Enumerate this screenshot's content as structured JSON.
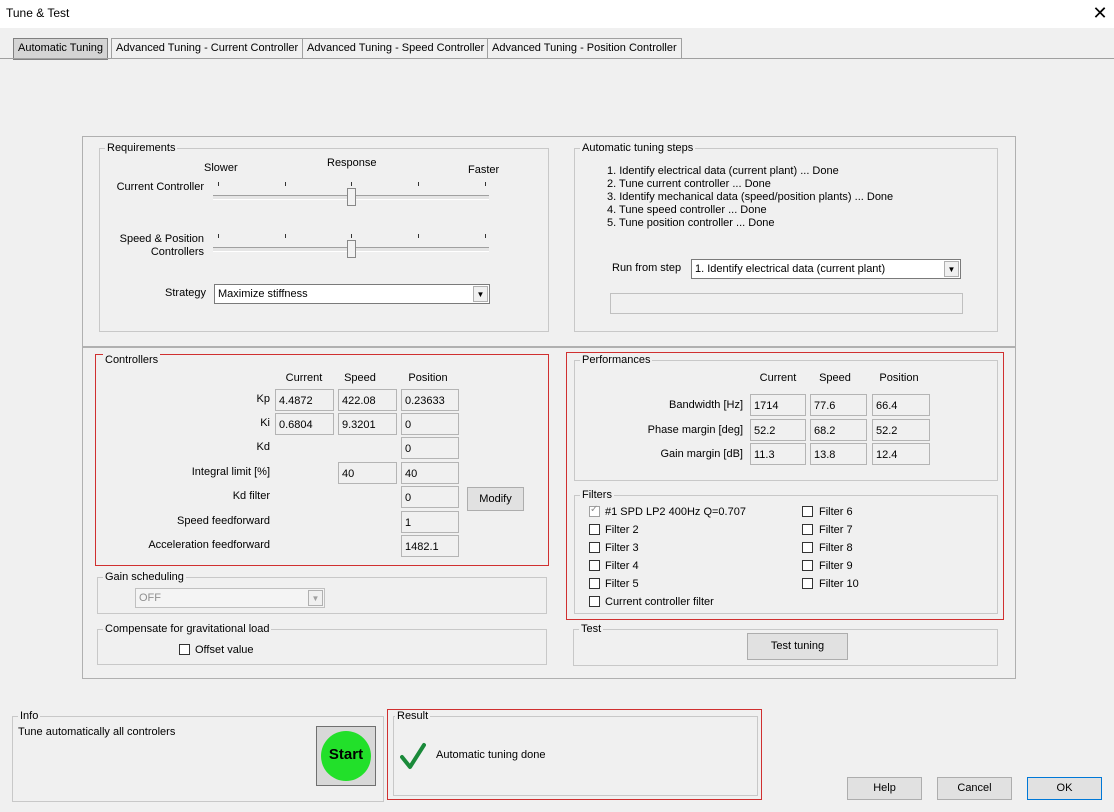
{
  "window": {
    "title": "Tune & Test"
  },
  "tabs": [
    "Automatic Tuning",
    "Advanced Tuning - Current Controller",
    "Advanced Tuning - Speed Controller",
    "Advanced Tuning - Position Controller"
  ],
  "requirements": {
    "label": "Requirements",
    "response": "Response",
    "slower": "Slower",
    "faster": "Faster",
    "current_controller": "Current Controller",
    "speed_position": "Speed & Position Controllers",
    "current_slider_position": 0.5,
    "speed_slider_position": 0.5,
    "strategy_label": "Strategy",
    "strategy_value": "Maximize stiffness"
  },
  "tuning_steps": {
    "label": "Automatic tuning steps",
    "steps": [
      "1. Identify electrical data (current plant) ... Done",
      "2. Tune current controller ... Done",
      "3. Identify mechanical data (speed/position plants) ... Done",
      "4. Tune speed controller ... Done",
      "5. Tune position controller ... Done"
    ],
    "run_from_label": "Run from step",
    "run_from_value": "1. Identify electrical data (current plant)"
  },
  "controllers": {
    "label": "Controllers",
    "headers": [
      "Current",
      "Speed",
      "Position"
    ],
    "kp_label": "Kp",
    "kp": [
      "4.4872",
      "422.08",
      "0.23633"
    ],
    "ki_label": "Ki",
    "ki": [
      "0.6804",
      "9.3201",
      "0"
    ],
    "kd_label": "Kd",
    "kd": "0",
    "integral_label": "Integral limit [%]",
    "integral": [
      "40",
      "40"
    ],
    "kdfilter_label": "Kd filter",
    "kdfilter": "0",
    "speedff_label": "Speed feedforward",
    "speedff": "1",
    "accelff_label": "Acceleration feedforward",
    "accelff": "1482.1",
    "modify": "Modify"
  },
  "gain_scheduling": {
    "label": "Gain scheduling",
    "value": "OFF"
  },
  "gravity": {
    "label": "Compensate for gravitational load",
    "offset": "Offset value"
  },
  "performances": {
    "label": "Performances",
    "headers": [
      "Current",
      "Speed",
      "Position"
    ],
    "bandwidth_label": "Bandwidth [Hz]",
    "bandwidth": [
      "1714",
      "77.6",
      "66.4"
    ],
    "phase_label": "Phase margin [deg]",
    "phase": [
      "52.2",
      "68.2",
      "52.2"
    ],
    "gain_label": "Gain margin [dB]",
    "gain": [
      "11.3",
      "13.8",
      "12.4"
    ]
  },
  "filters": {
    "label": "Filters",
    "left": [
      "#1 SPD LP2 400Hz Q=0.707",
      "Filter 2",
      "Filter 3",
      "Filter 4",
      "Filter 5",
      "Current controller filter"
    ],
    "right": [
      "Filter 6",
      "Filter 7",
      "Filter 8",
      "Filter 9",
      "Filter 10"
    ]
  },
  "test": {
    "label": "Test",
    "button": "Test tuning"
  },
  "info": {
    "label": "Info",
    "text": "Tune automatically all controlers",
    "start": "Start"
  },
  "result": {
    "label": "Result",
    "text": "Automatic tuning done"
  },
  "buttons": {
    "help": "Help",
    "cancel": "Cancel",
    "ok": "OK"
  },
  "colors": {
    "start_button": "#22e02a",
    "check_mark": "#1a8a3a",
    "highlight_border": "#d03030"
  }
}
